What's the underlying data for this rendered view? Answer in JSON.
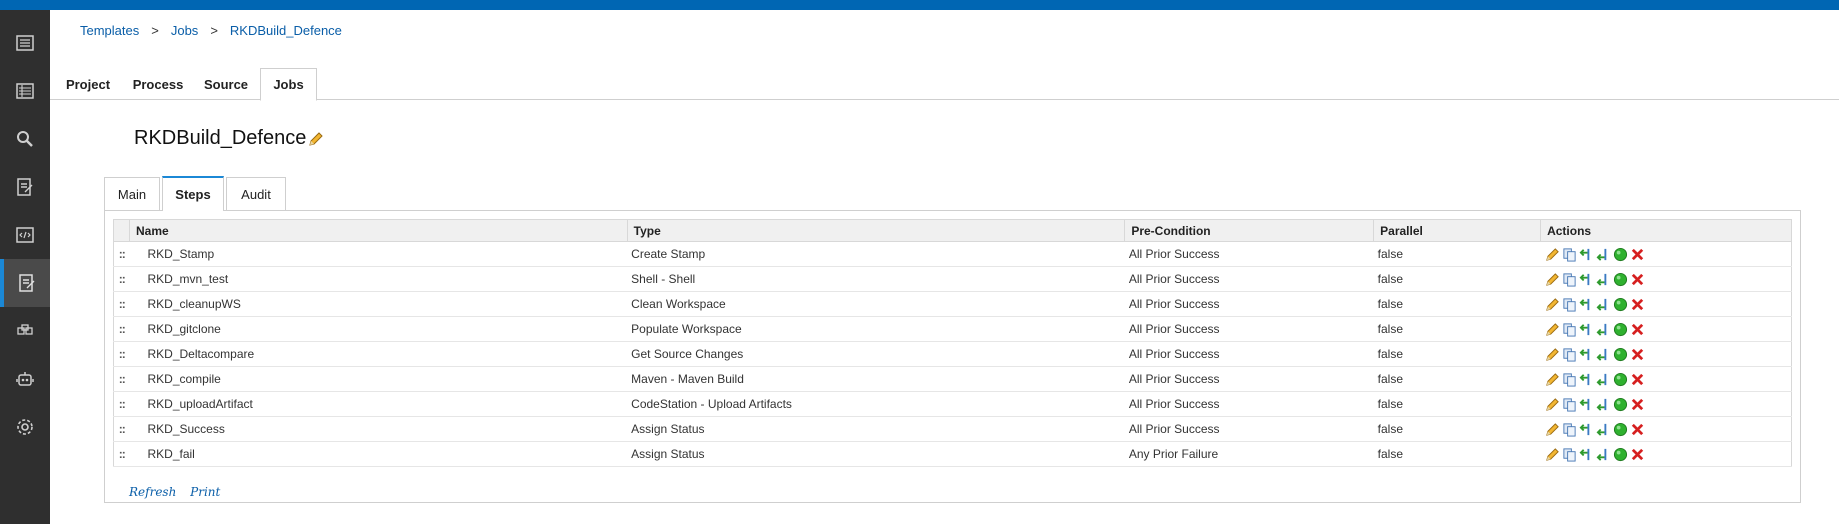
{
  "breadcrumb": {
    "items": [
      "Templates",
      "Jobs",
      "RKDBuild_Defence"
    ],
    "separator": ">"
  },
  "top_tabs": [
    "Project",
    "Process",
    "Source",
    "Jobs"
  ],
  "top_tabs_active": "Jobs",
  "page_title": "RKDBuild_Defence",
  "inner_tabs": [
    "Main",
    "Steps",
    "Audit"
  ],
  "inner_tabs_active": "Steps",
  "table": {
    "headers": [
      "Name",
      "Type",
      "Pre-Condition",
      "Parallel",
      "Actions"
    ],
    "handle_glyph": "::",
    "rows": [
      {
        "name": "RKD_Stamp",
        "type": "Create Stamp",
        "precondition": "All Prior Success",
        "parallel": "false"
      },
      {
        "name": "RKD_mvn_test",
        "type": "Shell - Shell",
        "precondition": "All Prior Success",
        "parallel": "false"
      },
      {
        "name": "RKD_cleanupWS",
        "type": "Clean Workspace",
        "precondition": "All Prior Success",
        "parallel": "false"
      },
      {
        "name": "RKD_gitclone",
        "type": "Populate Workspace",
        "precondition": "All Prior Success",
        "parallel": "false"
      },
      {
        "name": "RKD_Deltacompare",
        "type": "Get Source Changes",
        "precondition": "All Prior Success",
        "parallel": "false"
      },
      {
        "name": "RKD_compile",
        "type": "Maven - Maven Build",
        "precondition": "All Prior Success",
        "parallel": "false"
      },
      {
        "name": "RKD_uploadArtifact",
        "type": "CodeStation - Upload Artifacts",
        "precondition": "All Prior Success",
        "parallel": "false"
      },
      {
        "name": "RKD_Success",
        "type": "Assign Status",
        "precondition": "All Prior Success",
        "parallel": "false"
      },
      {
        "name": "RKD_fail",
        "type": "Assign Status",
        "precondition": "Any Prior Failure",
        "parallel": "false"
      }
    ],
    "action_icons": [
      "edit-icon",
      "copy-icon",
      "insert-before-icon",
      "insert-after-icon",
      "enable-icon",
      "delete-icon"
    ]
  },
  "footer_links": [
    "Refresh",
    "Print"
  ],
  "sidebar_icons": [
    "dashboard-icon",
    "list-icon",
    "search-icon",
    "reports-icon",
    "code-icon",
    "templates-icon",
    "resources-icon",
    "agents-icon",
    "settings-icon"
  ],
  "colors": {
    "top_bar": "#0066b3",
    "sidebar": "#2f2f2f",
    "link": "#0a5ea8",
    "active_tab_accent": "#1b88d6"
  }
}
